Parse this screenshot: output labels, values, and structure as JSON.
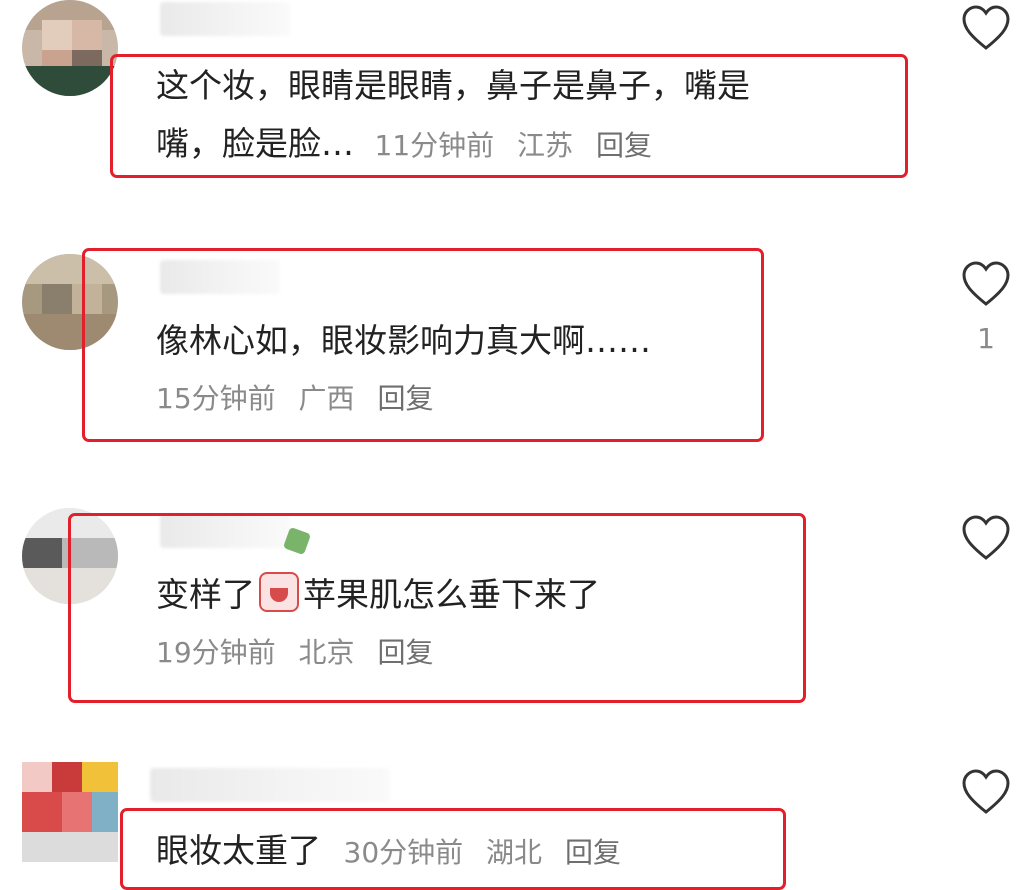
{
  "comments": [
    {
      "text_line1": "这个妆，眼睛是眼睛，鼻子是鼻子，嘴是",
      "text_line2": "嘴，脸是脸…",
      "time": "11分钟前",
      "location": "江苏",
      "reply_label": "回复",
      "likes": ""
    },
    {
      "text_line1": "像林心如，眼妆影响力真大啊……",
      "time": "15分钟前",
      "location": "广西",
      "reply_label": "回复",
      "likes": "1"
    },
    {
      "text_before_emoji": "变样了",
      "emoji_icon": "crying-face-icon",
      "text_after_emoji": "苹果肌怎么垂下来了",
      "time": "19分钟前",
      "location": "北京",
      "reply_label": "回复",
      "likes": ""
    },
    {
      "text_line1": "眼妆太重了",
      "time": "30分钟前",
      "location": "湖北",
      "reply_label": "回复",
      "likes": ""
    }
  ],
  "colors": {
    "highlight_border": "#e21f2a",
    "meta_text": "#8a8a8a",
    "icon_outline": "#333333"
  },
  "icons": {
    "like": "heart-outline-icon"
  }
}
